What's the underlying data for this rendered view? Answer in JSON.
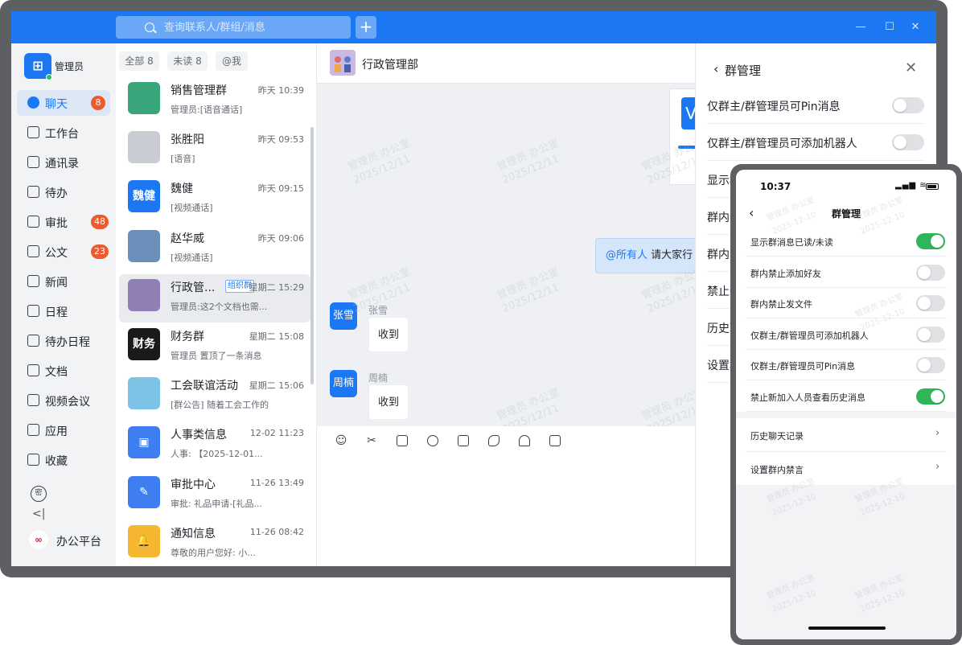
{
  "titlebar": {
    "search_placeholder": "查询联系人/群组/消息",
    "add_label": "+",
    "minimize": "—",
    "maximize": "☐",
    "close": "✕"
  },
  "user": {
    "name": "管理员",
    "status_color": "#29c25a"
  },
  "nav": {
    "items": [
      {
        "label": "聊天",
        "icon": "chat-icon",
        "badge": "8",
        "active": true
      },
      {
        "label": "工作台",
        "icon": "workbench-icon",
        "badge": ""
      },
      {
        "label": "通讯录",
        "icon": "contacts-icon",
        "badge": ""
      },
      {
        "label": "待办",
        "icon": "todo-icon",
        "badge": ""
      },
      {
        "label": "审批",
        "icon": "approval-icon",
        "badge": "48"
      },
      {
        "label": "公文",
        "icon": "document-icon",
        "badge": "23"
      },
      {
        "label": "新闻",
        "icon": "news-icon",
        "badge": ""
      },
      {
        "label": "日程",
        "icon": "calendar-icon",
        "badge": ""
      },
      {
        "label": "待办日程",
        "icon": "todo-calendar-icon",
        "badge": ""
      },
      {
        "label": "文档",
        "icon": "file-icon",
        "badge": ""
      },
      {
        "label": "视频会议",
        "icon": "video-meeting-icon",
        "badge": ""
      },
      {
        "label": "应用",
        "icon": "apps-icon",
        "badge": ""
      },
      {
        "label": "收藏",
        "icon": "favorites-icon",
        "badge": ""
      }
    ],
    "secret_label": "密",
    "collapse_label": "<|",
    "platform_label": "办公平台"
  },
  "tabs": [
    {
      "label": "全部 8",
      "active": true
    },
    {
      "label": "未读 8",
      "active": false
    },
    {
      "label": "@我",
      "active": false
    }
  ],
  "conversations": [
    {
      "name": "销售管理群",
      "time": "昨天 10:39",
      "preview": "管理员:[语音通话]",
      "tag": "",
      "avatar_text": "",
      "avatar_color": "#3aa57a"
    },
    {
      "name": "张胜阳",
      "time": "昨天 09:53",
      "preview": "[语音]",
      "tag": "",
      "avatar_text": "",
      "avatar_color": "#c9ccd2"
    },
    {
      "name": "魏健",
      "time": "昨天 09:15",
      "preview": "[视频通话]",
      "tag": "",
      "avatar_text": "魏健",
      "avatar_color": "#1b78f2"
    },
    {
      "name": "赵华威",
      "time": "昨天 09:06",
      "preview": "[视频通话]",
      "tag": "",
      "avatar_text": "",
      "avatar_color": "#6b8fb8"
    },
    {
      "name": "行政管...",
      "time": "星期二 15:29",
      "preview": "管理员:这2个文档也需...",
      "tag": "组织群",
      "avatar_text": "",
      "avatar_color": "#8f7fb5"
    },
    {
      "name": "财务群",
      "time": "星期二 15:08",
      "preview": "管理员 置顶了一条消息",
      "tag": "",
      "avatar_text": "财务",
      "avatar_color": "#1a1a1a"
    },
    {
      "name": "工会联谊活动",
      "time": "星期二 15:06",
      "preview": "[群公告] 随着工会工作的",
      "tag": "",
      "avatar_text": "",
      "avatar_color": "#7cc3e6"
    },
    {
      "name": "人事类信息",
      "time": "12-02 11:23",
      "preview": "人事: 【2025-12-01...",
      "tag": "",
      "avatar_text": "▣",
      "avatar_color": "#3f7ef0"
    },
    {
      "name": "审批中心",
      "time": "11-26 13:49",
      "preview": "审批: 礼品申请-[礼品...",
      "tag": "",
      "avatar_text": "✎",
      "avatar_color": "#3f7ef0"
    },
    {
      "name": "通知信息",
      "time": "11-26 08:42",
      "preview": "尊敬的用户您好: 小...",
      "tag": "",
      "avatar_text": "🔔",
      "avatar_color": "#f5b731"
    }
  ],
  "chat": {
    "title": "行政管理部",
    "card_letter": "V",
    "mention_at": "@所有人",
    "mention_text": " 请大家行",
    "messages": [
      {
        "avatar": "张雪",
        "sender": "张雪",
        "text": "收到"
      },
      {
        "avatar": "周楠",
        "sender": "周楠",
        "text": "收到"
      }
    ],
    "watermark_line1": "管理员 办公室",
    "watermark_line2": "2025/12/11"
  },
  "toolbar": {
    "tools": [
      "emoji-icon",
      "scissors-icon",
      "forward-icon",
      "history-icon",
      "note-icon",
      "call-icon",
      "meeting-icon",
      "folder-icon"
    ],
    "emoji": "☺",
    "scissors": "✂"
  },
  "panel": {
    "back": "‹",
    "title": "群管理",
    "close": "✕",
    "rows": [
      {
        "label": "仅群主/群管理员可Pin消息",
        "switch": true,
        "on": false
      },
      {
        "label": "仅群主/群管理员可添加机器人",
        "switch": true,
        "on": false
      },
      {
        "label": "显示群",
        "switch": false
      },
      {
        "label": "群内禁",
        "switch": false
      },
      {
        "label": "群内禁",
        "switch": false
      },
      {
        "label": "禁止新",
        "switch": false
      },
      {
        "label": "历史聊",
        "switch": false
      },
      {
        "label": "设置群",
        "switch": false
      }
    ]
  },
  "phone": {
    "time": "10:37",
    "signal": "▂▄▆ ≋",
    "back": "‹",
    "title": "群管理",
    "toggles": [
      {
        "label": "显示群消息已读/未读",
        "on": true
      },
      {
        "label": "群内禁止添加好友",
        "on": false
      },
      {
        "label": "群内禁止发文件",
        "on": false
      },
      {
        "label": "仅群主/群管理员可添加机器人",
        "on": false
      },
      {
        "label": "仅群主/群管理员可Pin消息",
        "on": false
      },
      {
        "label": "禁止新加入人员查看历史消息",
        "on": true
      }
    ],
    "links": [
      {
        "label": "历史聊天记录",
        "arrow": "›"
      },
      {
        "label": "设置群内禁言",
        "arrow": "›"
      }
    ],
    "watermark_line1": "管理员 办公室",
    "watermark_line2": "2025-12-10"
  },
  "colors": {
    "brand": "#1b78f2",
    "badge": "#ec5b2f",
    "switch_on": "#2fb65a"
  }
}
